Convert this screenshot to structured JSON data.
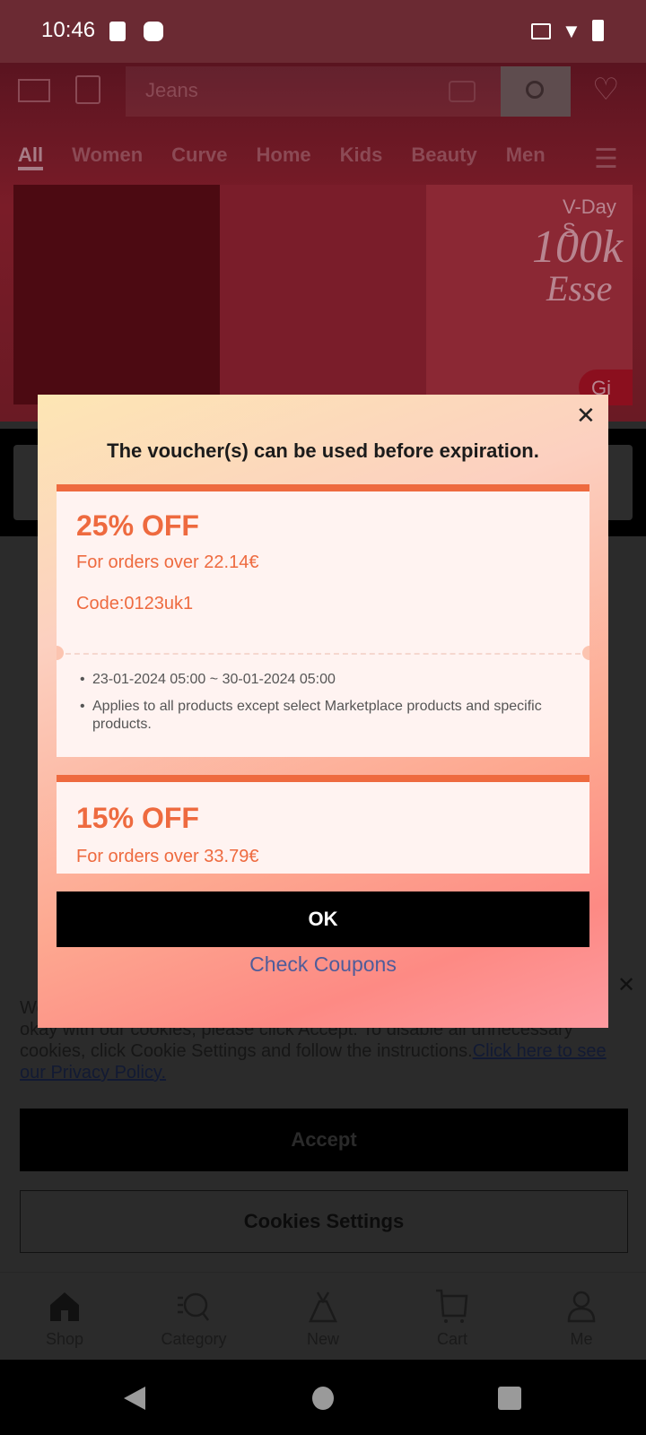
{
  "status_bar": {
    "time": "10:46"
  },
  "header": {
    "search_placeholder": "Jeans",
    "tabs": [
      "All",
      "Women",
      "Curve",
      "Home",
      "Kids",
      "Beauty",
      "Men"
    ]
  },
  "banner": {
    "line1": "V-Day S",
    "line2": "100k",
    "line3": "Esse",
    "button": "Gi"
  },
  "dialog": {
    "title": "The voucher(s) can be used before expiration.",
    "vouchers": [
      {
        "discount": "25% OFF",
        "condition": "For orders over 22.14€",
        "code": "Code:0123uk1",
        "validity": "23-01-2024  05:00 ~ 30-01-2024  05:00",
        "note": "Applies to all products except select Marketplace products and specific products."
      },
      {
        "discount": "15% OFF",
        "condition": "For orders over 33.79€"
      }
    ],
    "ok_label": "OK",
    "check_coupons_label": "Check Coupons",
    "accent_color": "#ee6a3f"
  },
  "cookie": {
    "text_hidden_start": "We",
    "text": "okay with our cookies, please click Accept.  To disable all unnecessary cookies, click Cookie Settings and follow the instructions.",
    "link": "Click here to see our Privacy Policy.",
    "accept_label": "Accept",
    "settings_label": "Cookies Settings"
  },
  "bottom_nav": [
    {
      "label": "Shop",
      "icon": "home-icon"
    },
    {
      "label": "Category",
      "icon": "category-search-icon"
    },
    {
      "label": "New",
      "icon": "dress-icon"
    },
    {
      "label": "Cart",
      "icon": "cart-icon"
    },
    {
      "label": "Me",
      "icon": "person-icon"
    }
  ]
}
